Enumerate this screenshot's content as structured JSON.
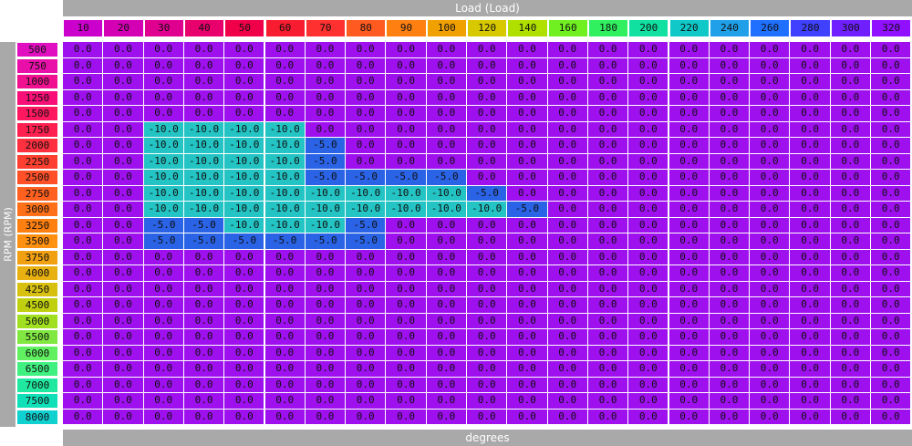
{
  "top_axis_label": "Load (Load)",
  "left_axis_label": "RPM (RPM)",
  "bottom_label": "degrees",
  "columns": [
    {
      "label": "10",
      "color": "#cc00cc"
    },
    {
      "label": "20",
      "color": "#d400b4"
    },
    {
      "label": "30",
      "color": "#e00090"
    },
    {
      "label": "40",
      "color": "#e8006c"
    },
    {
      "label": "50",
      "color": "#f00048"
    },
    {
      "label": "60",
      "color": "#f81c30"
    },
    {
      "label": "70",
      "color": "#ff3030"
    },
    {
      "label": "80",
      "color": "#ff5a20"
    },
    {
      "label": "90",
      "color": "#ff8010"
    },
    {
      "label": "100",
      "color": "#f0a000"
    },
    {
      "label": "120",
      "color": "#d8c800"
    },
    {
      "label": "140",
      "color": "#b0e000"
    },
    {
      "label": "160",
      "color": "#70f020"
    },
    {
      "label": "180",
      "color": "#30f060"
    },
    {
      "label": "200",
      "color": "#10e0a0"
    },
    {
      "label": "220",
      "color": "#10c8c8"
    },
    {
      "label": "240",
      "color": "#20a0e8"
    },
    {
      "label": "260",
      "color": "#2070ff"
    },
    {
      "label": "280",
      "color": "#4040ff"
    },
    {
      "label": "300",
      "color": "#7020ff"
    },
    {
      "label": "320",
      "color": "#9010ff"
    }
  ],
  "rows": [
    {
      "label": "500",
      "color": "#e010c0"
    },
    {
      "label": "750",
      "color": "#e810a8"
    },
    {
      "label": "1000",
      "color": "#f01090"
    },
    {
      "label": "1250",
      "color": "#f81078"
    },
    {
      "label": "1500",
      "color": "#ff1860"
    },
    {
      "label": "1750",
      "color": "#ff2050"
    },
    {
      "label": "2000",
      "color": "#ff3040"
    },
    {
      "label": "2250",
      "color": "#ff4030"
    },
    {
      "label": "2500",
      "color": "#ff5028"
    },
    {
      "label": "2750",
      "color": "#ff6020"
    },
    {
      "label": "3000",
      "color": "#ff7018"
    },
    {
      "label": "3250",
      "color": "#ff8010"
    },
    {
      "label": "3500",
      "color": "#ff9010"
    },
    {
      "label": "3750",
      "color": "#f0a010"
    },
    {
      "label": "4000",
      "color": "#e8b010"
    },
    {
      "label": "4250",
      "color": "#d8c010"
    },
    {
      "label": "4500",
      "color": "#c0d010"
    },
    {
      "label": "5000",
      "color": "#a0e020"
    },
    {
      "label": "5500",
      "color": "#80e840"
    },
    {
      "label": "6000",
      "color": "#60f060"
    },
    {
      "label": "6500",
      "color": "#40f080"
    },
    {
      "label": "7000",
      "color": "#20e8a0"
    },
    {
      "label": "7500",
      "color": "#10e0b8"
    },
    {
      "label": "8000",
      "color": "#10d0d0"
    }
  ],
  "values": [
    [
      "0.0",
      "0.0",
      "0.0",
      "0.0",
      "0.0",
      "0.0",
      "0.0",
      "0.0",
      "0.0",
      "0.0",
      "0.0",
      "0.0",
      "0.0",
      "0.0",
      "0.0",
      "0.0",
      "0.0",
      "0.0",
      "0.0",
      "0.0",
      "0.0"
    ],
    [
      "0.0",
      "0.0",
      "0.0",
      "0.0",
      "0.0",
      "0.0",
      "0.0",
      "0.0",
      "0.0",
      "0.0",
      "0.0",
      "0.0",
      "0.0",
      "0.0",
      "0.0",
      "0.0",
      "0.0",
      "0.0",
      "0.0",
      "0.0",
      "0.0"
    ],
    [
      "0.0",
      "0.0",
      "0.0",
      "0.0",
      "0.0",
      "0.0",
      "0.0",
      "0.0",
      "0.0",
      "0.0",
      "0.0",
      "0.0",
      "0.0",
      "0.0",
      "0.0",
      "0.0",
      "0.0",
      "0.0",
      "0.0",
      "0.0",
      "0.0"
    ],
    [
      "0.0",
      "0.0",
      "0.0",
      "0.0",
      "0.0",
      "0.0",
      "0.0",
      "0.0",
      "0.0",
      "0.0",
      "0.0",
      "0.0",
      "0.0",
      "0.0",
      "0.0",
      "0.0",
      "0.0",
      "0.0",
      "0.0",
      "0.0",
      "0.0"
    ],
    [
      "0.0",
      "0.0",
      "0.0",
      "0.0",
      "0.0",
      "0.0",
      "0.0",
      "0.0",
      "0.0",
      "0.0",
      "0.0",
      "0.0",
      "0.0",
      "0.0",
      "0.0",
      "0.0",
      "0.0",
      "0.0",
      "0.0",
      "0.0",
      "0.0"
    ],
    [
      "0.0",
      "0.0",
      "-10.0",
      "-10.0",
      "-10.0",
      "-10.0",
      "0.0",
      "0.0",
      "0.0",
      "0.0",
      "0.0",
      "0.0",
      "0.0",
      "0.0",
      "0.0",
      "0.0",
      "0.0",
      "0.0",
      "0.0",
      "0.0",
      "0.0"
    ],
    [
      "0.0",
      "0.0",
      "-10.0",
      "-10.0",
      "-10.0",
      "-10.0",
      "-5.0",
      "0.0",
      "0.0",
      "0.0",
      "0.0",
      "0.0",
      "0.0",
      "0.0",
      "0.0",
      "0.0",
      "0.0",
      "0.0",
      "0.0",
      "0.0",
      "0.0"
    ],
    [
      "0.0",
      "0.0",
      "-10.0",
      "-10.0",
      "-10.0",
      "-10.0",
      "-5.0",
      "0.0",
      "0.0",
      "0.0",
      "0.0",
      "0.0",
      "0.0",
      "0.0",
      "0.0",
      "0.0",
      "0.0",
      "0.0",
      "0.0",
      "0.0",
      "0.0"
    ],
    [
      "0.0",
      "0.0",
      "-10.0",
      "-10.0",
      "-10.0",
      "-10.0",
      "-5.0",
      "-5.0",
      "-5.0",
      "-5.0",
      "0.0",
      "0.0",
      "0.0",
      "0.0",
      "0.0",
      "0.0",
      "0.0",
      "0.0",
      "0.0",
      "0.0",
      "0.0"
    ],
    [
      "0.0",
      "0.0",
      "-10.0",
      "-10.0",
      "-10.0",
      "-10.0",
      "-10.0",
      "-10.0",
      "-10.0",
      "-10.0",
      "-5.0",
      "0.0",
      "0.0",
      "0.0",
      "0.0",
      "0.0",
      "0.0",
      "0.0",
      "0.0",
      "0.0",
      "0.0"
    ],
    [
      "0.0",
      "0.0",
      "-10.0",
      "-10.0",
      "-10.0",
      "-10.0",
      "-10.0",
      "-10.0",
      "-10.0",
      "-10.0",
      "-10.0",
      "-5.0",
      "0.0",
      "0.0",
      "0.0",
      "0.0",
      "0.0",
      "0.0",
      "0.0",
      "0.0",
      "0.0"
    ],
    [
      "0.0",
      "0.0",
      "-5.0",
      "-5.0",
      "-10.0",
      "-10.0",
      "-10.0",
      "-5.0",
      "0.0",
      "0.0",
      "0.0",
      "0.0",
      "0.0",
      "0.0",
      "0.0",
      "0.0",
      "0.0",
      "0.0",
      "0.0",
      "0.0",
      "0.0"
    ],
    [
      "0.0",
      "0.0",
      "-5.0",
      "-5.0",
      "-5.0",
      "-5.0",
      "-5.0",
      "-5.0",
      "0.0",
      "0.0",
      "0.0",
      "0.0",
      "0.0",
      "0.0",
      "0.0",
      "0.0",
      "0.0",
      "0.0",
      "0.0",
      "0.0",
      "0.0"
    ],
    [
      "0.0",
      "0.0",
      "0.0",
      "0.0",
      "0.0",
      "0.0",
      "0.0",
      "0.0",
      "0.0",
      "0.0",
      "0.0",
      "0.0",
      "0.0",
      "0.0",
      "0.0",
      "0.0",
      "0.0",
      "0.0",
      "0.0",
      "0.0",
      "0.0"
    ],
    [
      "0.0",
      "0.0",
      "0.0",
      "0.0",
      "0.0",
      "0.0",
      "0.0",
      "0.0",
      "0.0",
      "0.0",
      "0.0",
      "0.0",
      "0.0",
      "0.0",
      "0.0",
      "0.0",
      "0.0",
      "0.0",
      "0.0",
      "0.0",
      "0.0"
    ],
    [
      "0.0",
      "0.0",
      "0.0",
      "0.0",
      "0.0",
      "0.0",
      "0.0",
      "0.0",
      "0.0",
      "0.0",
      "0.0",
      "0.0",
      "0.0",
      "0.0",
      "0.0",
      "0.0",
      "0.0",
      "0.0",
      "0.0",
      "0.0",
      "0.0"
    ],
    [
      "0.0",
      "0.0",
      "0.0",
      "0.0",
      "0.0",
      "0.0",
      "0.0",
      "0.0",
      "0.0",
      "0.0",
      "0.0",
      "0.0",
      "0.0",
      "0.0",
      "0.0",
      "0.0",
      "0.0",
      "0.0",
      "0.0",
      "0.0",
      "0.0"
    ],
    [
      "0.0",
      "0.0",
      "0.0",
      "0.0",
      "0.0",
      "0.0",
      "0.0",
      "0.0",
      "0.0",
      "0.0",
      "0.0",
      "0.0",
      "0.0",
      "0.0",
      "0.0",
      "0.0",
      "0.0",
      "0.0",
      "0.0",
      "0.0",
      "0.0"
    ],
    [
      "0.0",
      "0.0",
      "0.0",
      "0.0",
      "0.0",
      "0.0",
      "0.0",
      "0.0",
      "0.0",
      "0.0",
      "0.0",
      "0.0",
      "0.0",
      "0.0",
      "0.0",
      "0.0",
      "0.0",
      "0.0",
      "0.0",
      "0.0",
      "0.0"
    ],
    [
      "0.0",
      "0.0",
      "0.0",
      "0.0",
      "0.0",
      "0.0",
      "0.0",
      "0.0",
      "0.0",
      "0.0",
      "0.0",
      "0.0",
      "0.0",
      "0.0",
      "0.0",
      "0.0",
      "0.0",
      "0.0",
      "0.0",
      "0.0",
      "0.0"
    ],
    [
      "0.0",
      "0.0",
      "0.0",
      "0.0",
      "0.0",
      "0.0",
      "0.0",
      "0.0",
      "0.0",
      "0.0",
      "0.0",
      "0.0",
      "0.0",
      "0.0",
      "0.0",
      "0.0",
      "0.0",
      "0.0",
      "0.0",
      "0.0",
      "0.0"
    ],
    [
      "0.0",
      "0.0",
      "0.0",
      "0.0",
      "0.0",
      "0.0",
      "0.0",
      "0.0",
      "0.0",
      "0.0",
      "0.0",
      "0.0",
      "0.0",
      "0.0",
      "0.0",
      "0.0",
      "0.0",
      "0.0",
      "0.0",
      "0.0",
      "0.0"
    ],
    [
      "0.0",
      "0.0",
      "0.0",
      "0.0",
      "0.0",
      "0.0",
      "0.0",
      "0.0",
      "0.0",
      "0.0",
      "0.0",
      "0.0",
      "0.0",
      "0.0",
      "0.0",
      "0.0",
      "0.0",
      "0.0",
      "0.0",
      "0.0",
      "0.0"
    ],
    [
      "0.0",
      "0.0",
      "0.0",
      "0.0",
      "0.0",
      "0.0",
      "0.0",
      "0.0",
      "0.0",
      "0.0",
      "0.0",
      "0.0",
      "0.0",
      "0.0",
      "0.0",
      "0.0",
      "0.0",
      "0.0",
      "0.0",
      "0.0",
      "0.0"
    ]
  ],
  "value_colors": {
    "0.0": "#9e10ee",
    "-5.0": "#2a63e6",
    "-10.0": "#24c4c4"
  }
}
